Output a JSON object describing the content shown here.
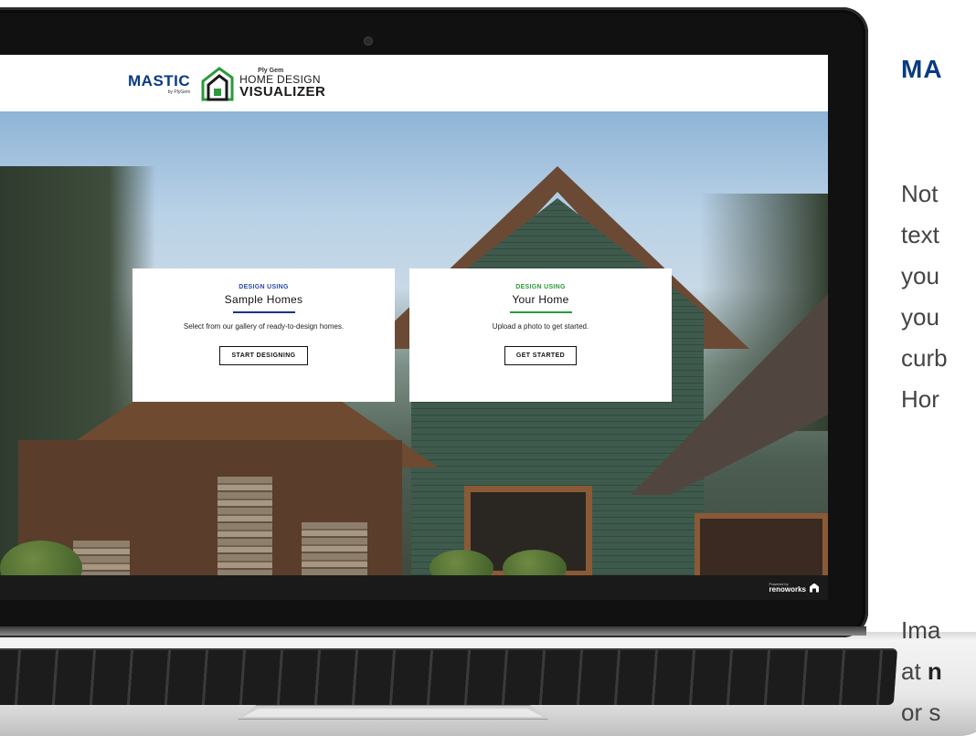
{
  "app": {
    "brand": "MASTIC",
    "brand_by": "by PlyGem",
    "product_small": "Ply Gem",
    "product_line1": "HOME DESIGN",
    "product_line2": "VISUALIZER"
  },
  "cards": [
    {
      "eyebrow": "DESIGN USING",
      "title": "Sample Homes",
      "description": "Select from our gallery of ready-to-design homes.",
      "button": "START DESIGNING"
    },
    {
      "eyebrow": "DESIGN USING",
      "title": "Your Home",
      "description": "Upload a photo to get started.",
      "button": "GET STARTED"
    }
  ],
  "footer": {
    "powered_by": "Powered by",
    "brand": "renoworks"
  },
  "side": {
    "title": "MA",
    "lines": [
      "Not",
      "text",
      "you",
      "you",
      "curb",
      "Hor"
    ],
    "lines2_prefix": [
      "Ima",
      "at ",
      "or s"
    ],
    "lines2_bold": "n"
  },
  "colors": {
    "mastic_blue": "#0a3a82",
    "sample_accent": "#1e2f8a",
    "your_accent": "#2a9a3a"
  }
}
